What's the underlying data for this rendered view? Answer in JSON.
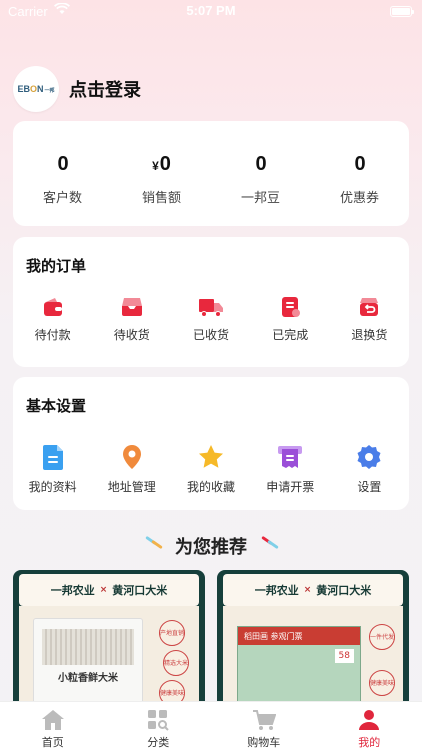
{
  "status_bar": {
    "carrier": "Carrier",
    "time": "5:07 PM"
  },
  "profile": {
    "login_label": "点击登录",
    "avatar_text_left": "EB",
    "avatar_text_o": "O",
    "avatar_text_right": "N",
    "avatar_text_small": "一邦"
  },
  "stats": [
    {
      "value": "0",
      "currency": "",
      "label": "客户数"
    },
    {
      "value": "0",
      "currency": "¥",
      "label": "销售额"
    },
    {
      "value": "0",
      "currency": "",
      "label": "一邦豆"
    },
    {
      "value": "0",
      "currency": "",
      "label": "优惠券"
    }
  ],
  "orders": {
    "title": "我的订单",
    "items": [
      {
        "label": "待付款",
        "icon": "wallet-icon"
      },
      {
        "label": "待收货",
        "icon": "inbox-icon"
      },
      {
        "label": "已收货",
        "icon": "truck-icon"
      },
      {
        "label": "已完成",
        "icon": "checklist-icon"
      },
      {
        "label": "退换货",
        "icon": "return-icon"
      }
    ]
  },
  "settings": {
    "title": "基本设置",
    "items": [
      {
        "label": "我的资料",
        "icon": "document-icon"
      },
      {
        "label": "地址管理",
        "icon": "location-pin-icon"
      },
      {
        "label": "我的收藏",
        "icon": "star-icon"
      },
      {
        "label": "申请开票",
        "icon": "invoice-icon"
      },
      {
        "label": "设置",
        "icon": "gear-icon"
      }
    ]
  },
  "recommend": {
    "title": "为您推荐",
    "products": [
      {
        "banner_left": "一邦农业",
        "banner_x": "×",
        "banner_right": "黄河口大米",
        "bag_name": "小粒香鲜大米",
        "badges": [
          "产地直销",
          "精选大米",
          "健康美味"
        ]
      },
      {
        "banner_left": "一邦农业",
        "banner_x": "×",
        "banner_right": "黄河口大米",
        "board_title": "稻田画 参观门票",
        "board_price": "58",
        "badges": [
          "一件代发",
          "健康美味"
        ]
      }
    ]
  },
  "tabbar": [
    {
      "label": "首页",
      "icon": "home-icon",
      "active": false
    },
    {
      "label": "分类",
      "icon": "category-icon",
      "active": false
    },
    {
      "label": "购物车",
      "icon": "cart-icon",
      "active": false
    },
    {
      "label": "我的",
      "icon": "user-icon",
      "active": true
    }
  ],
  "colors": {
    "accent": "#e0263c",
    "orange": "#f08a3c",
    "gold": "#f6b928",
    "purple": "#9b4fd8",
    "blue": "#4a7de8",
    "dark_green": "#163f3b"
  }
}
